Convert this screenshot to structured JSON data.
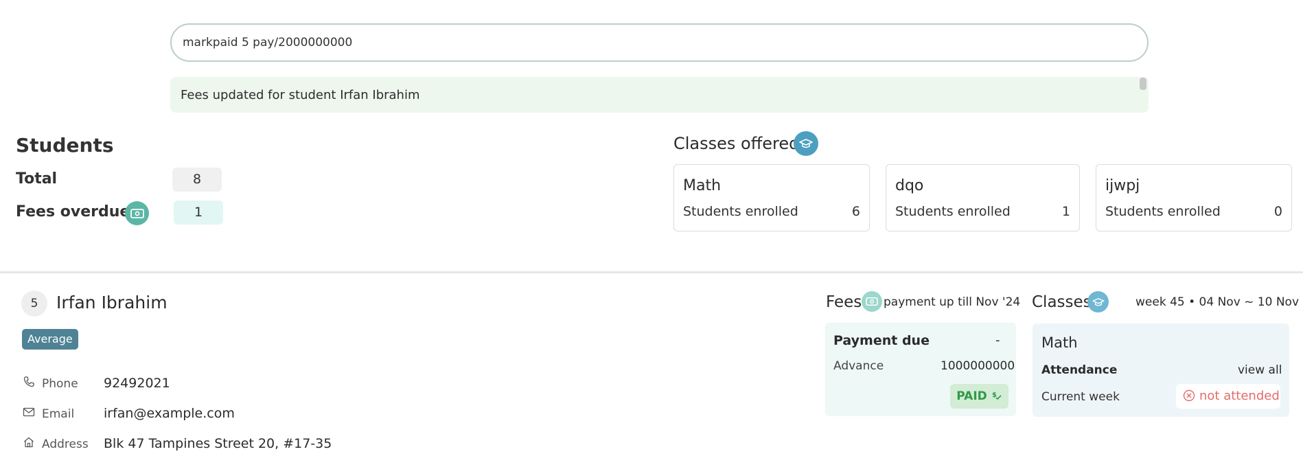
{
  "command": {
    "value": "markpaid 5 pay/2000000000"
  },
  "result": {
    "message": "Fees updated for student Irfan Ibrahim"
  },
  "students_summary": {
    "title": "Students",
    "total_label": "Total",
    "total_value": "8",
    "overdue_label": "Fees overdue",
    "overdue_value": "1"
  },
  "classes_offered": {
    "title": "Classes offered",
    "enrolled_label": "Students enrolled",
    "cards": [
      {
        "name": "Math",
        "count": "6"
      },
      {
        "name": "dqo",
        "count": "1"
      },
      {
        "name": "ijwpj",
        "count": "0"
      }
    ]
  },
  "student": {
    "index": "5",
    "name": "Irfan Ibrahim",
    "tag": "Average",
    "phone_label": "Phone",
    "phone": "92492021",
    "email_label": "Email",
    "email": "irfan@example.com",
    "address_label": "Address",
    "address": "Blk 47 Tampines Street 20, #17-35"
  },
  "fees": {
    "title": "Fees",
    "note": "payment up till Nov '24",
    "payment_due_label": "Payment due",
    "payment_due_value": "-",
    "advance_label": "Advance",
    "advance_value": "1000000000",
    "status": "PAID"
  },
  "classes": {
    "title": "Classes",
    "week": "week 45 • 04 Nov ~ 10 Nov",
    "class_name": "Math",
    "attendance_label": "Attendance",
    "view_all": "view all",
    "current_week_label": "Current week",
    "current_week_status": "not attended"
  },
  "colors": {
    "accent_teal": "#5bb6a6",
    "accent_blue": "#4d9fbf",
    "tag_bg": "#4e8294",
    "paid_green": "#2f9a48",
    "absent_red": "#e56a6a"
  },
  "icons": [
    "money-icon",
    "graduation-cap-icon",
    "phone-icon",
    "email-icon",
    "home-icon",
    "money-check-icon",
    "x-circle-icon"
  ]
}
